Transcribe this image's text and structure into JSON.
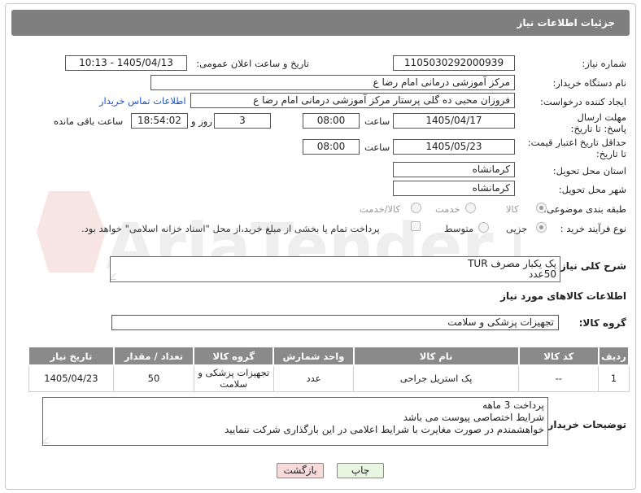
{
  "header": {
    "title": "جزئیات اطلاعات نیاز"
  },
  "fields": {
    "need_number_label": "شماره نیاز:",
    "need_number": "1105030292000939",
    "announce_label": "تاریخ و ساعت اعلان عمومی:",
    "announce_value": "1405/04/13 - 10:13",
    "buyer_label": "نام دستگاه خریدار:",
    "buyer_value": "مرکز آموزشی  درمانی امام رضا  ع",
    "creator_label": "ایجاد کننده درخواست:",
    "creator_value": "فروزان محبی ده گلی پرستار مرکز آموزشی  درمانی امام رضا  ع",
    "contact_link": "اطلاعات تماس خریدار",
    "deadline_label": "مهلت ارسال پاسخ: تا تاریخ:",
    "deadline_date": "1405/04/17",
    "time_label": "ساعت",
    "deadline_time": "08:00",
    "days_value": "3",
    "days_label": "روز و",
    "remaining_time": "18:54:02",
    "remaining_label": "ساعت باقی مانده",
    "validity_label": "حداقل تاریخ اعتبار قیمت: تا تاریخ:",
    "validity_date": "1405/05/23",
    "validity_time": "08:00",
    "province_label": "استان محل تحویل:",
    "province_value": "کرمانشاه",
    "city_label": "شهر محل تحویل:",
    "city_value": "کرمانشاه",
    "category_label": "طبقه بندی موضوعی:",
    "category_options": [
      "کالا",
      "خدمت",
      "کالا/خدمت"
    ],
    "process_label": "نوع فرآیند خرید :",
    "process_options": [
      "جزیی",
      "متوسط"
    ],
    "payment_note": "پرداخت تمام یا بخشی از مبلغ خرید،از محل \"اسناد خزانه اسلامی\" خواهد بود."
  },
  "description": {
    "label": "شرح کلی نیاز:",
    "line1": "پک یکبار مصرف    TUR",
    "line2": "50عدد"
  },
  "goods_info_title": "اطلاعات کالاهای مورد نیاز",
  "goods_group": {
    "label": "گروه کالا:",
    "value": "تجهیزات پزشکی و سلامت"
  },
  "table": {
    "headers": [
      "ردیف",
      "کد کالا",
      "نام کالا",
      "واحد شمارش",
      "گروه کالا",
      "تعداد / مقدار",
      "تاریخ نیاز"
    ],
    "rows": [
      [
        "1",
        "--",
        "پک استریل جراحی",
        "عدد",
        "تجهیزات پزشکی و سلامت",
        "50",
        "1405/04/23"
      ]
    ]
  },
  "buyer_notes": {
    "label": "توضیحات خریدار:",
    "line1": "پرداخت 3 ماهه",
    "line2": "شرایط اختصاصی پیوست می باشد",
    "line3": "خواهشمندم  در صورت مغایرت با شرایط اعلامی در این بارگذاری شرکت ننمایید"
  },
  "buttons": {
    "print": "چاپ",
    "back": "بازگشت"
  },
  "watermark_text": "AriaTender.neT",
  "colors": {
    "header_bg": "#7f7f7f",
    "link": "#1a55c8",
    "back_btn": "#f7dada",
    "print_btn": "#e8f5e0"
  }
}
